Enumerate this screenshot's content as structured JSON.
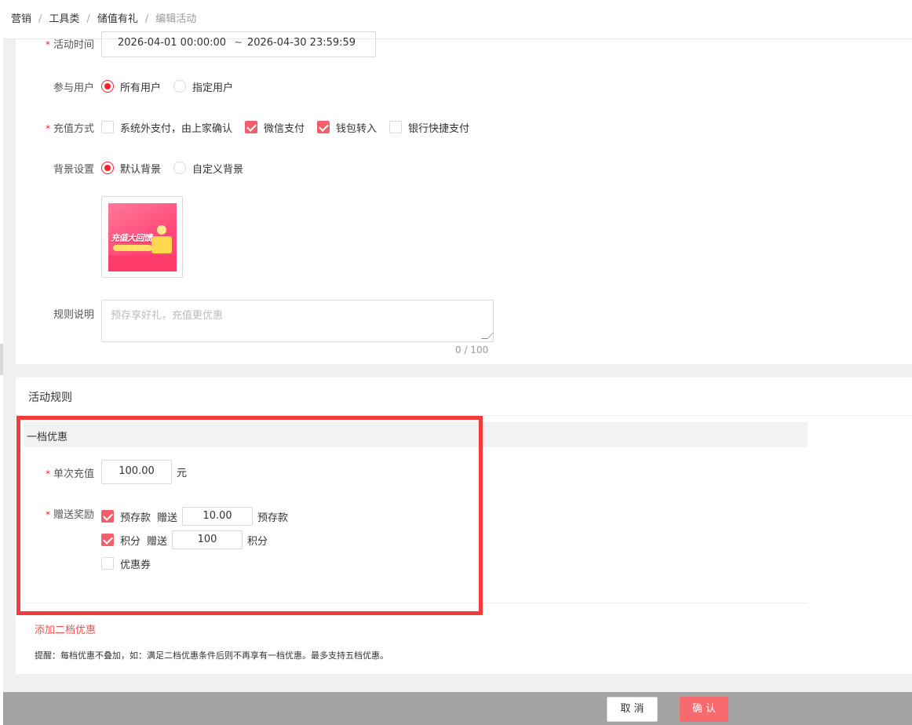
{
  "breadcrumb": {
    "items": [
      "营销",
      "工具类",
      "储值有礼"
    ],
    "current": "编辑活动",
    "separator": "/"
  },
  "form": {
    "activity_time": {
      "label": "活动时间",
      "start": "2026-04-01 00:00:00",
      "separator": "~",
      "end": "2026-04-30 23:59:59"
    },
    "participants": {
      "label": "参与用户",
      "options": [
        {
          "label": "所有用户",
          "selected": true
        },
        {
          "label": "指定用户",
          "selected": false
        }
      ]
    },
    "recharge_methods": {
      "label": "充值方式",
      "options": [
        {
          "label": "系统外支付，由上家确认",
          "checked": false
        },
        {
          "label": "微信支付",
          "checked": true
        },
        {
          "label": "钱包转入",
          "checked": true
        },
        {
          "label": "银行快捷支付",
          "checked": false
        }
      ]
    },
    "background": {
      "label": "背景设置",
      "options": [
        {
          "label": "默认背景",
          "selected": true
        },
        {
          "label": "自定义背景",
          "selected": false
        }
      ],
      "thumbnail_text": "充值大回馈"
    },
    "rules": {
      "label": "规则说明",
      "placeholder": "预存享好礼，充值更优惠",
      "counter": "0 / 100"
    }
  },
  "activity_rules": {
    "title": "活动规则",
    "tier": {
      "title": "一档优惠",
      "single_recharge": {
        "label": "单次充值",
        "value": "100.00",
        "unit": "元"
      },
      "rewards": {
        "label": "赠送奖励",
        "items": [
          {
            "label": "预存款",
            "checked": true,
            "give": "赠送",
            "value": "10.00",
            "unit": "预存款"
          },
          {
            "label": "积分",
            "checked": true,
            "give": "赠送",
            "value": "100",
            "unit": "积分"
          },
          {
            "label": "优惠券",
            "checked": false
          }
        ]
      }
    },
    "add_tier": "添加二档优惠",
    "tip": "提醒：每档优惠不叠加，如：满足二档优惠条件后则不再享有一档优惠。最多支持五档优惠。"
  },
  "footer": {
    "cancel": "取消",
    "confirm": "确认"
  },
  "colors": {
    "accent": "#f5222d",
    "checkbox": "#f25f6a",
    "confirm_button": "#f76a6d",
    "highlight_box": "#f23b3b"
  }
}
